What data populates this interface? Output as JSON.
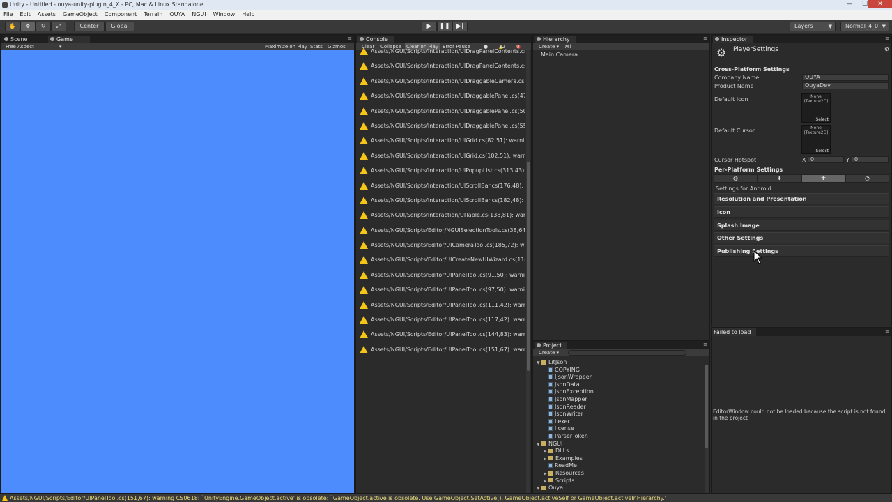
{
  "window": {
    "title": "Unity - Untitled - ouya-unity-plugin_4_X - PC, Mac & Linux Standalone",
    "min": "—",
    "max": "☐",
    "close": "✕"
  },
  "menu": [
    "File",
    "Edit",
    "Assets",
    "GameObject",
    "Component",
    "Terrain",
    "OUYA",
    "NGUI",
    "Window",
    "Help"
  ],
  "toolbar": {
    "center": "Center",
    "global": "Global",
    "layers": "Layers",
    "layout": "Normal_4_0"
  },
  "scene_tabs": {
    "scene": "Scene",
    "game": "Game",
    "aspect": "Free Aspect",
    "maximize": "Maximize on Play",
    "stats": "Stats",
    "gizmos": "Gizmos"
  },
  "console": {
    "tab": "Console",
    "buttons": {
      "clear": "Clear",
      "collapse": "Collapse",
      "clear_on_play": "Clear on Play",
      "error_pause": "Error Pause"
    },
    "counts": {
      "info": "0",
      "warn": "32",
      "error": "0"
    },
    "rows": [
      "Assets/NGUI/Scripts/Interaction/UIDragPanelContents.cs(",
      "Assets/NGUI/Scripts/Interaction/UIDragPanelContents.cs(",
      "Assets/NGUI/Scripts/Interaction/UIDraggableCamera.cs(1",
      "Assets/NGUI/Scripts/Interaction/UIDraggablePanel.cs(471",
      "Assets/NGUI/Scripts/Interaction/UIDraggablePanel.cs(507",
      "Assets/NGUI/Scripts/Interaction/UIDraggablePanel.cs(550",
      "Assets/NGUI/Scripts/Interaction/UIGrid.cs(82,51): warnin",
      "Assets/NGUI/Scripts/Interaction/UIGrid.cs(102,51): warni",
      "Assets/NGUI/Scripts/Interaction/UIPopupList.cs(313,43): ",
      "Assets/NGUI/Scripts/Interaction/UIScrollBar.cs(176,48): ",
      "Assets/NGUI/Scripts/Interaction/UIScrollBar.cs(182,48): ",
      "Assets/NGUI/Scripts/Interaction/UITable.cs(138,81): warn",
      "Assets/NGUI/Scripts/Editor/NGUISelectionTools.cs(38,64)",
      "Assets/NGUI/Scripts/Editor/UICameraTool.cs(185,72): wa",
      "Assets/NGUI/Scripts/Editor/UICreateNewUIWizard.cs(114,",
      "Assets/NGUI/Scripts/Editor/UIPanelTool.cs(91,50): warnin",
      "Assets/NGUI/Scripts/Editor/UIPanelTool.cs(97,50): warnin",
      "Assets/NGUI/Scripts/Editor/UIPanelTool.cs(111,42): warni",
      "Assets/NGUI/Scripts/Editor/UIPanelTool.cs(117,42): warni",
      "Assets/NGUI/Scripts/Editor/UIPanelTool.cs(144,83): warni",
      "Assets/NGUI/Scripts/Editor/UIPanelTool.cs(151,67): warni"
    ]
  },
  "hierarchy": {
    "tab": "Hierarchy",
    "create": "Create ▾",
    "search": "All",
    "items": [
      "Main Camera"
    ]
  },
  "project": {
    "tab": "Project",
    "create": "Create ▾",
    "tree": [
      {
        "label": "LitJson",
        "type": "folder",
        "depth": 0,
        "open": true
      },
      {
        "label": "COPYING",
        "type": "file",
        "depth": 1
      },
      {
        "label": "IJsonWrapper",
        "type": "file",
        "depth": 1
      },
      {
        "label": "JsonData",
        "type": "file",
        "depth": 1
      },
      {
        "label": "JsonException",
        "type": "file",
        "depth": 1
      },
      {
        "label": "JsonMapper",
        "type": "file",
        "depth": 1
      },
      {
        "label": "JsonReader",
        "type": "file",
        "depth": 1
      },
      {
        "label": "JsonWriter",
        "type": "file",
        "depth": 1
      },
      {
        "label": "Lexer",
        "type": "file",
        "depth": 1
      },
      {
        "label": "license",
        "type": "file",
        "depth": 1
      },
      {
        "label": "ParserToken",
        "type": "file",
        "depth": 1
      },
      {
        "label": "NGUI",
        "type": "folder",
        "depth": 0,
        "open": true
      },
      {
        "label": "DLLs",
        "type": "folder",
        "depth": 1,
        "open": false
      },
      {
        "label": "Examples",
        "type": "folder",
        "depth": 1,
        "open": false
      },
      {
        "label": "ReadMe",
        "type": "file",
        "depth": 1
      },
      {
        "label": "Resources",
        "type": "folder",
        "depth": 1,
        "open": false
      },
      {
        "label": "Scripts",
        "type": "folder",
        "depth": 1,
        "open": false
      },
      {
        "label": "Ouya",
        "type": "folder",
        "depth": 0,
        "open": true
      }
    ]
  },
  "inspector": {
    "tab": "Inspector",
    "title": "PlayerSettings",
    "cross_platform": "Cross-Platform Settings",
    "company_label": "Company Name",
    "company_value": "OUYA",
    "product_label": "Product Name",
    "product_value": "OuyaDev",
    "default_icon": "Default Icon",
    "default_cursor": "Default Cursor",
    "tex_none": "None",
    "tex_type": "(Texture2D)",
    "select": "Select",
    "hotspot": "Cursor Hotspot",
    "hx_label": "X",
    "hx": "0",
    "hy_label": "Y",
    "hy": "0",
    "per_platform": "Per-Platform Settings",
    "settings_for": "Settings for Android",
    "sections": [
      "Resolution and Presentation",
      "Icon",
      "Splash Image",
      "Other Settings",
      "Publishing Settings"
    ]
  },
  "failed": {
    "tab": "Failed to load",
    "message": "EditorWindow could not be loaded because the script is not found in the project"
  },
  "status": "Assets/NGUI/Scripts/Editor/UIPanelTool.cs(151,67): warning CS0618: `UnityEngine.GameObject.active' is obsolete: `GameObject.active is obsolete. Use GameObject.SetActive(), GameObject.activeSelf or GameObject.activeInHierarchy.'",
  "colors": {
    "game_bg": "#4d8cfd",
    "warning": "#f5c518"
  }
}
